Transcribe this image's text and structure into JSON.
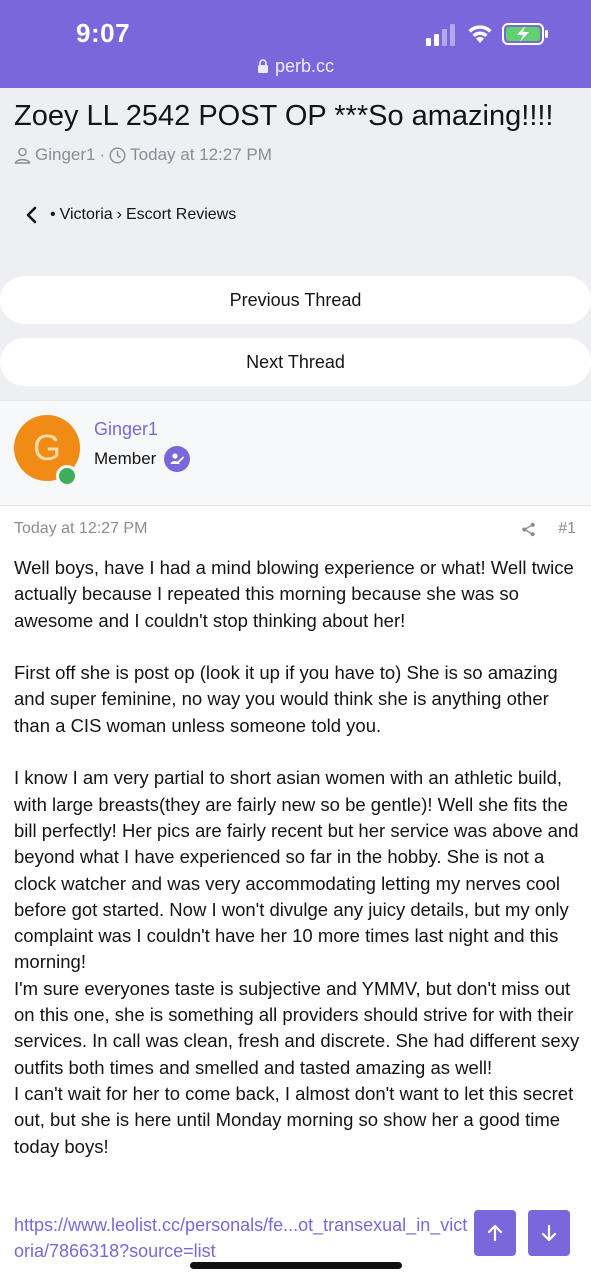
{
  "status_bar": {
    "time": "9:07",
    "url": "perb.cc"
  },
  "thread": {
    "title": "Zoey LL 2542 POST OP ***So amazing!!!!",
    "author": "Ginger1",
    "separator": "·",
    "date": "Today at 12:27 PM"
  },
  "breadcrumb": {
    "prefix": "•",
    "items": [
      "Victoria",
      "Escort Reviews"
    ],
    "sep": "›"
  },
  "nav": {
    "previous": "Previous Thread",
    "next": "Next Thread"
  },
  "author_box": {
    "avatar_letter": "G",
    "username": "Ginger1",
    "role": "Member"
  },
  "post": {
    "date": "Today at 12:27 PM",
    "number": "#1",
    "paragraphs": [
      "Well boys, have I had a mind blowing experience or what! Well twice actually because I repeated this morning because she was so awesome and I couldn't stop thinking about her!",
      "First off she is post op (look it up if you have to) She is so amazing and super feminine, no way you would think she is anything other than a CIS woman unless someone told you.",
      "I know I am very partial to short asian women with an athletic build, with large breasts(they are fairly new so be gentle)! Well she fits the bill perfectly! Her pics are fairly recent but her service was above and beyond what I have experienced so far in the hobby. She is not a clock watcher and was very accommodating letting my nerves cool before got started. Now I won't divulge any juicy details, but my only complaint was I couldn't have her 10 more times last night and this morning!",
      "I'm sure everyones taste is subjective and YMMV, but don't miss out on this one, she is something all providers should strive for with their services. In call was clean, fresh and discrete. She had different sexy outfits both times and smelled and tasted amazing as well!",
      "I can't wait for her to come back, I almost don't want to let this secret out, but she is here until Monday morning so show her a good time today boys!"
    ],
    "link": "https://www.leolist.cc/personals/fe...ot_transexual_in_victoria/7866318?source=list"
  },
  "colors": {
    "accent": "#7b67dc",
    "avatar": "#f08c16",
    "online": "#3fae5a"
  },
  "icons": [
    "signal-icon",
    "wifi-icon",
    "battery-charging-icon",
    "lock-icon",
    "user-icon",
    "clock-icon",
    "back-chevron-icon",
    "share-icon",
    "arrow-up-icon",
    "arrow-down-icon"
  ]
}
